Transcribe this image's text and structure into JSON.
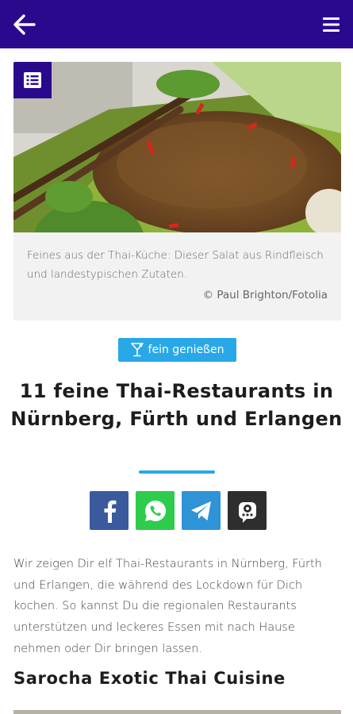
{
  "hero": {
    "caption": "Feines aus der Thai-Küche: Dieser Salat aus Rindfleisch und landestypischen Zutaten.",
    "credit": "© Paul Brighton/Fotolia"
  },
  "category": {
    "label": "fein genießen",
    "icon": "cocktail-glass-icon"
  },
  "article": {
    "title": "11 feine Thai-Restaurants in Nürnberg, Fürth und Erlangen",
    "intro": "Wir zeigen Dir elf Thai-Restaurants in Nürnberg, Fürth und Erlangen, die während des Lockdown für Dich kochen. So kannst Du die regionalen Restaurants unterstützen und leckeres Essen mit nach Hause nehmen oder Dir bringen lassen.",
    "section_heading": "Sarocha Exotic Thai Cuisine"
  },
  "colors": {
    "header": "#2a0a8c",
    "accent": "#29a8e8",
    "facebook": "#3b5a9e",
    "whatsapp": "#2ecc4d",
    "telegram": "#2f93d8",
    "other_share": "#2e2e2e"
  },
  "icons": {
    "back": "arrow-left-icon",
    "menu": "hamburger-menu-icon",
    "list": "list-icon",
    "share": [
      "facebook-icon",
      "whatsapp-icon",
      "telegram-icon",
      "chat-bot-icon"
    ]
  }
}
